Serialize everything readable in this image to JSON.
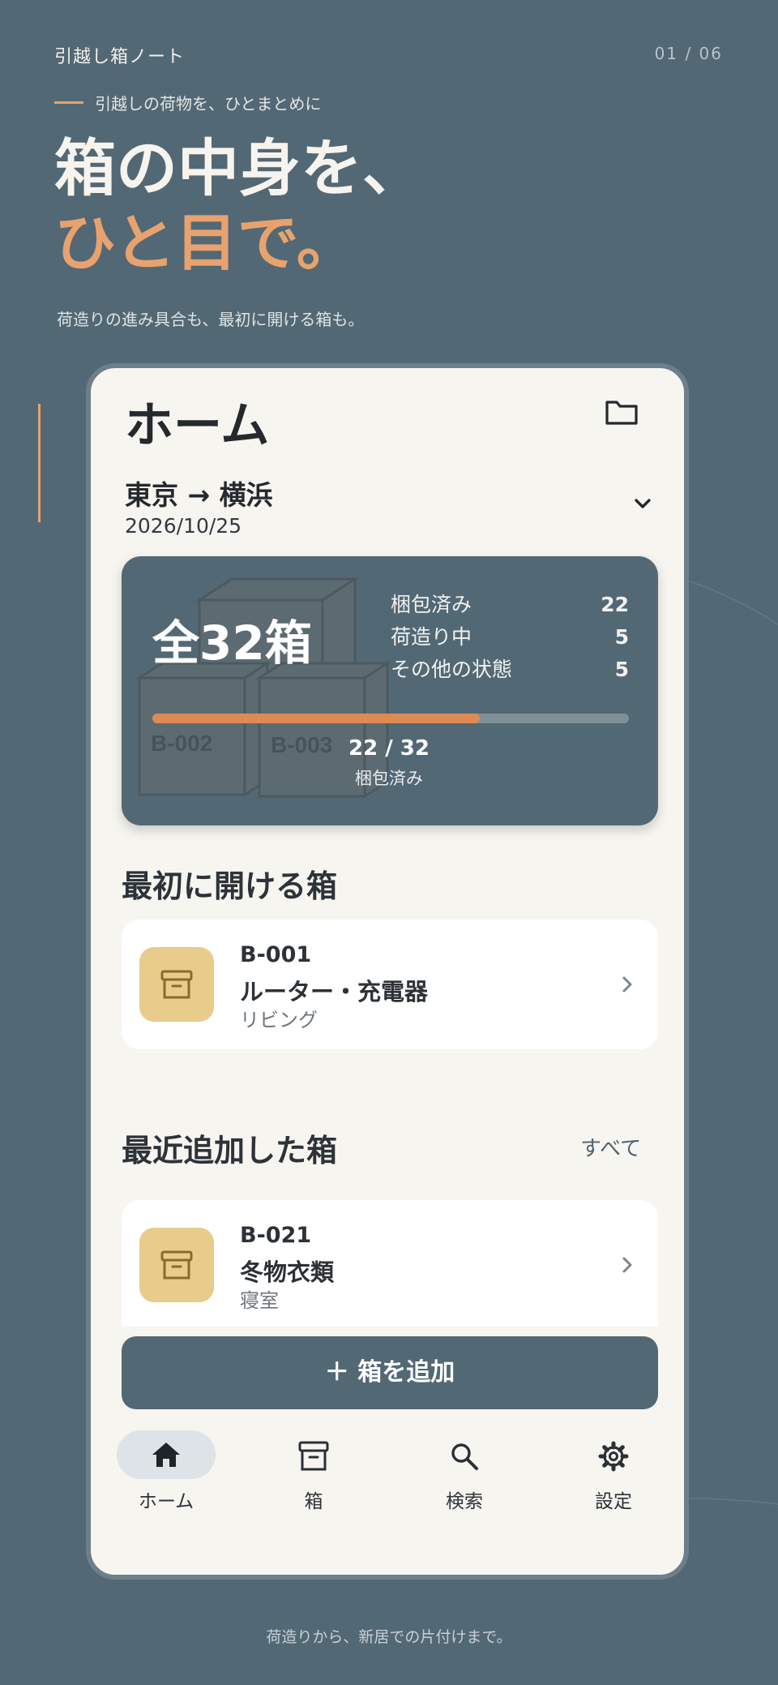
{
  "header": {
    "app_name": "引越し箱ノート",
    "page_indicator": "01 / 06",
    "tagline": "引越しの荷物を、ひとまとめに",
    "hero_line1": "箱の中身を、",
    "hero_line2": "ひと目で。",
    "subtitle": "荷造りの進み具合も、最初に開ける箱も。"
  },
  "colors": {
    "background": "#526875",
    "accent": "#e7a26e",
    "progress_fill": "#dd8b55",
    "card_icon_bg": "#e8cc8c",
    "phone_bg": "#f7f5f0"
  },
  "app": {
    "title": "ホーム",
    "folder_icon": "folder-icon",
    "move": {
      "route": "東京 → 横浜",
      "date": "2026/10/25"
    },
    "summary": {
      "total_label": "全32箱",
      "stats": [
        {
          "label": "梱包済み",
          "value": "22"
        },
        {
          "label": "荷造り中",
          "value": "5"
        },
        {
          "label": "その他の状態",
          "value": "5"
        }
      ],
      "progress": {
        "done": 22,
        "total": 32,
        "text": "22 / 32",
        "label": "梱包済み"
      },
      "background_boxes": [
        "B-002",
        "B-003"
      ]
    },
    "first_open": {
      "title": "最初に開ける箱",
      "items": [
        {
          "code": "B-001",
          "name": "ルーター・充電器",
          "room": "リビング"
        }
      ]
    },
    "recent": {
      "title": "最近追加した箱",
      "see_all": "すべて",
      "items": [
        {
          "code": "B-021",
          "name": "冬物衣類",
          "room": "寝室"
        }
      ]
    },
    "add_button": "＋ 箱を追加",
    "tabs": [
      {
        "label": "ホーム",
        "icon": "home-icon",
        "active": true
      },
      {
        "label": "箱",
        "icon": "box-icon",
        "active": false
      },
      {
        "label": "検索",
        "icon": "search-icon",
        "active": false
      },
      {
        "label": "設定",
        "icon": "settings-icon",
        "active": false
      }
    ]
  },
  "footer": {
    "text": "荷造りから、新居での片付けまで。"
  }
}
